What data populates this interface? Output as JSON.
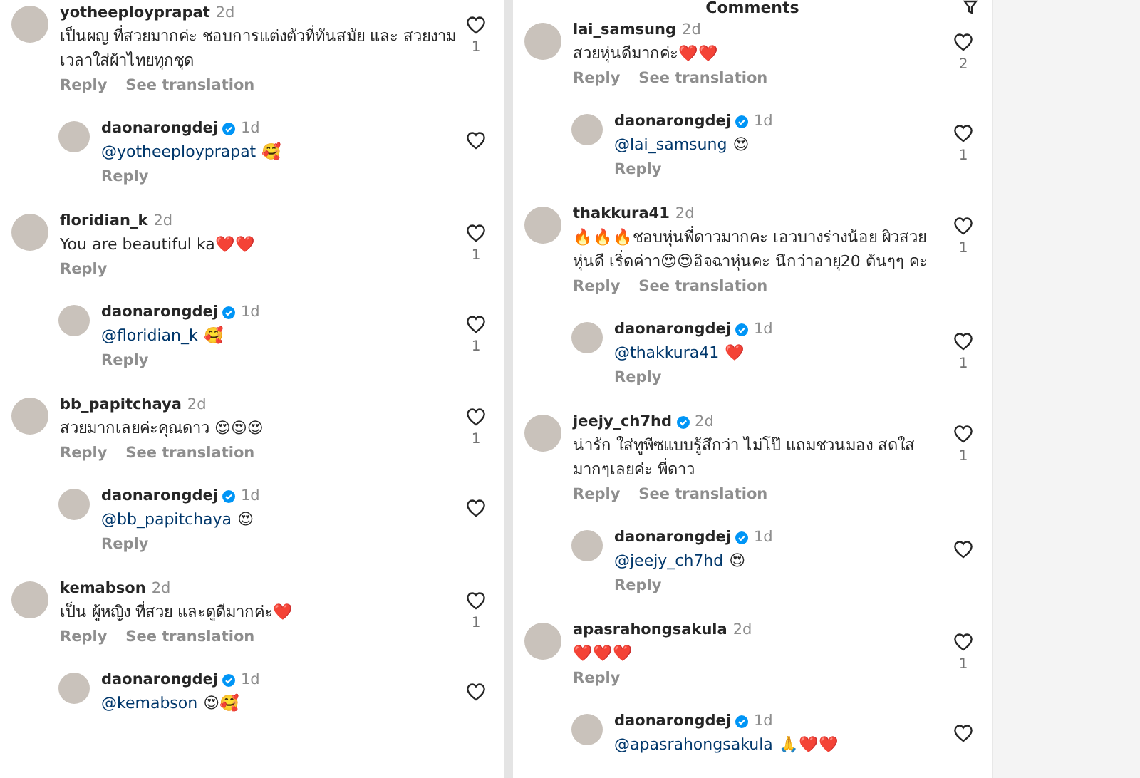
{
  "panels": [
    {
      "comments": [
        {
          "username": "yotheeployprapat",
          "verified": false,
          "time": "2d",
          "text": "เป็นผญ ที่สวยมากค่ะ ชอบการแต่งตัวที่ทันสมัย และ สวยงามเวลาใส่ผ้าไทยทุกชุด",
          "actions": [
            "Reply",
            "See translation"
          ],
          "likes": "1",
          "replies": [
            {
              "username": "daonarongdej",
              "verified": true,
              "time": "1d",
              "mention": "@yotheeployprapat",
              "text": "🥰",
              "actions": [
                "Reply"
              ]
            }
          ]
        },
        {
          "username": "floridian_k",
          "verified": false,
          "time": "2d",
          "text": "You are beautiful ka❤️❤️",
          "actions": [
            "Reply"
          ],
          "likes": "1",
          "replies": [
            {
              "username": "daonarongdej",
              "verified": true,
              "time": "1d",
              "mention": "@floridian_k",
              "text": "🥰",
              "actions": [
                "Reply"
              ],
              "likes": "1"
            }
          ]
        },
        {
          "username": "bb_papitchaya",
          "verified": false,
          "time": "2d",
          "text": "สวยมากเลยค่ะคุณดาว 😍😍😍",
          "actions": [
            "Reply",
            "See translation"
          ],
          "likes": "1",
          "replies": [
            {
              "username": "daonarongdej",
              "verified": true,
              "time": "1d",
              "mention": "@bb_papitchaya",
              "text": "😍",
              "actions": [
                "Reply"
              ]
            }
          ]
        },
        {
          "username": "kemabson",
          "verified": false,
          "time": "2d",
          "text": "เป็น ผู้หญิง ที่สวย และดูดีมากค่ะ❤️",
          "actions": [
            "Reply",
            "See translation"
          ],
          "likes": "1",
          "replies": [
            {
              "username": "daonarongdej",
              "verified": true,
              "time": "1d",
              "mention": "@kemabson",
              "text": "😍🥰"
            }
          ]
        }
      ]
    },
    {
      "title": "Comments",
      "comments": [
        {
          "username": "lai_samsung",
          "verified": false,
          "time": "2d",
          "text": "สวยหุ่นดีมากค่ะ❤️❤️",
          "actions": [
            "Reply",
            "See translation"
          ],
          "likes": "2",
          "replies": [
            {
              "username": "daonarongdej",
              "verified": true,
              "time": "1d",
              "mention": "@lai_samsung",
              "text": "😍",
              "actions": [
                "Reply"
              ],
              "likes": "1"
            }
          ]
        },
        {
          "username": "thakkura41",
          "verified": false,
          "time": "2d",
          "text": "🔥🔥🔥ชอบหุ่นพี่ดาวมากคะ เอวบางร่างน้อย ผิวสวย หุ่นดี เริ่ดค่าา😍😍อิจฉาหุ่นคะ นึกว่าอายุ20 ต้นๆๆ คะ",
          "actions": [
            "Reply",
            "See translation"
          ],
          "likes": "1",
          "replies": [
            {
              "username": "daonarongdej",
              "verified": true,
              "time": "1d",
              "mention": "@thakkura41",
              "text": "❤️",
              "actions": [
                "Reply"
              ],
              "likes": "1"
            }
          ]
        },
        {
          "username": "jeejy_ch7hd",
          "verified": true,
          "time": "2d",
          "text": "น่ารัก ใส่ทูพีซแบบรู้สึกว่า ไม่โป๊ แถมชวนมอง สดใส มากๆเลยค่ะ พี่ดาว",
          "actions": [
            "Reply",
            "See translation"
          ],
          "likes": "1",
          "replies": [
            {
              "username": "daonarongdej",
              "verified": true,
              "time": "1d",
              "mention": "@jeejy_ch7hd",
              "text": "😍",
              "actions": [
                "Reply"
              ]
            }
          ]
        },
        {
          "username": "apasrahongsakula",
          "verified": false,
          "time": "2d",
          "text": "❤️❤️❤️",
          "actions": [
            "Reply"
          ],
          "likes": "1",
          "replies": [
            {
              "username": "daonarongdej",
              "verified": true,
              "time": "1d",
              "mention": "@apasrahongsakula",
              "text": "🙏❤️❤️"
            }
          ]
        }
      ]
    }
  ]
}
